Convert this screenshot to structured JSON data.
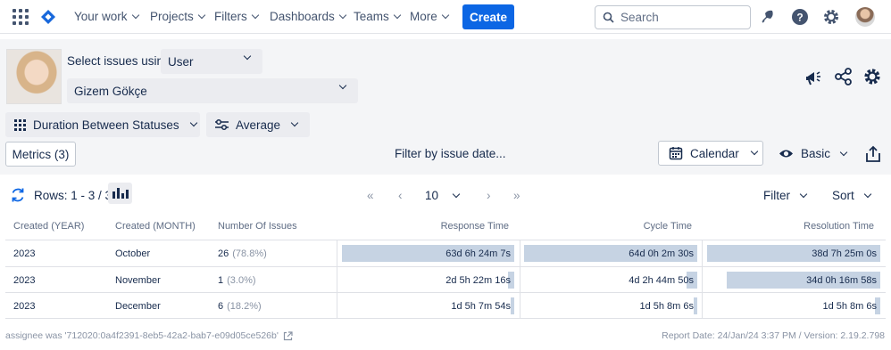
{
  "nav": {
    "items": [
      {
        "label": "Your work"
      },
      {
        "label": "Projects"
      },
      {
        "label": "Filters"
      },
      {
        "label": "Dashboards"
      },
      {
        "label": "Teams"
      },
      {
        "label": "More"
      }
    ],
    "create_label": "Create",
    "search_placeholder": "Search"
  },
  "controls": {
    "select_issues_label": "Select issues using",
    "select_by": "User",
    "user_name": "Gizem Gökçe",
    "report_type": "Duration Between Statuses",
    "aggregation": "Average",
    "metrics_label": "Metrics (3)",
    "filter_date_label": "Filter by issue date...",
    "calendar_label": "Calendar",
    "view_mode": "Basic"
  },
  "toolbar": {
    "rows_label": "Rows: 1 - 3 / 3",
    "page_size": "10",
    "filter_label": "Filter",
    "sort_label": "Sort"
  },
  "table": {
    "columns": [
      "Created (YEAR)",
      "Created (MONTH)",
      "Number Of Issues",
      "Response Time",
      "Cycle Time",
      "Resolution Time"
    ],
    "rows": [
      {
        "year": "2023",
        "month": "October",
        "count": "26",
        "pct": "(78.8%)",
        "response": "63d 6h 24m 7s",
        "response_frac": 1.0,
        "cycle": "64d 0h 2m 30s",
        "cycle_frac": 1.0,
        "resolution": "38d 7h 25m 0s",
        "resolution_frac": 1.0
      },
      {
        "year": "2023",
        "month": "November",
        "count": "1",
        "pct": "(3.0%)",
        "response": "2d 5h 22m 16s",
        "response_frac": 0.035,
        "cycle": "4d 2h 44m 50s",
        "cycle_frac": 0.064,
        "resolution": "34d 0h 16m 58s",
        "resolution_frac": 0.888
      },
      {
        "year": "2023",
        "month": "December",
        "count": "6",
        "pct": "(18.2%)",
        "response": "1d 5h 7m 54s",
        "response_frac": 0.019,
        "cycle": "1d 5h 8m 6s",
        "cycle_frac": 0.018,
        "resolution": "1d 5h 8m 6s",
        "resolution_frac": 0.032
      }
    ]
  },
  "footer": {
    "query": "assignee was '712020:0a4f2391-8eb5-42a2-bab7-e09d05ce526b'",
    "report_info": "Report Date: 24/Jan/24 3:37 PM / Version: 2.19.2.798"
  },
  "colors": {
    "brand": "#0c66e4",
    "bar": "#c6d3e3",
    "panel_bg": "#f4f5f7"
  }
}
